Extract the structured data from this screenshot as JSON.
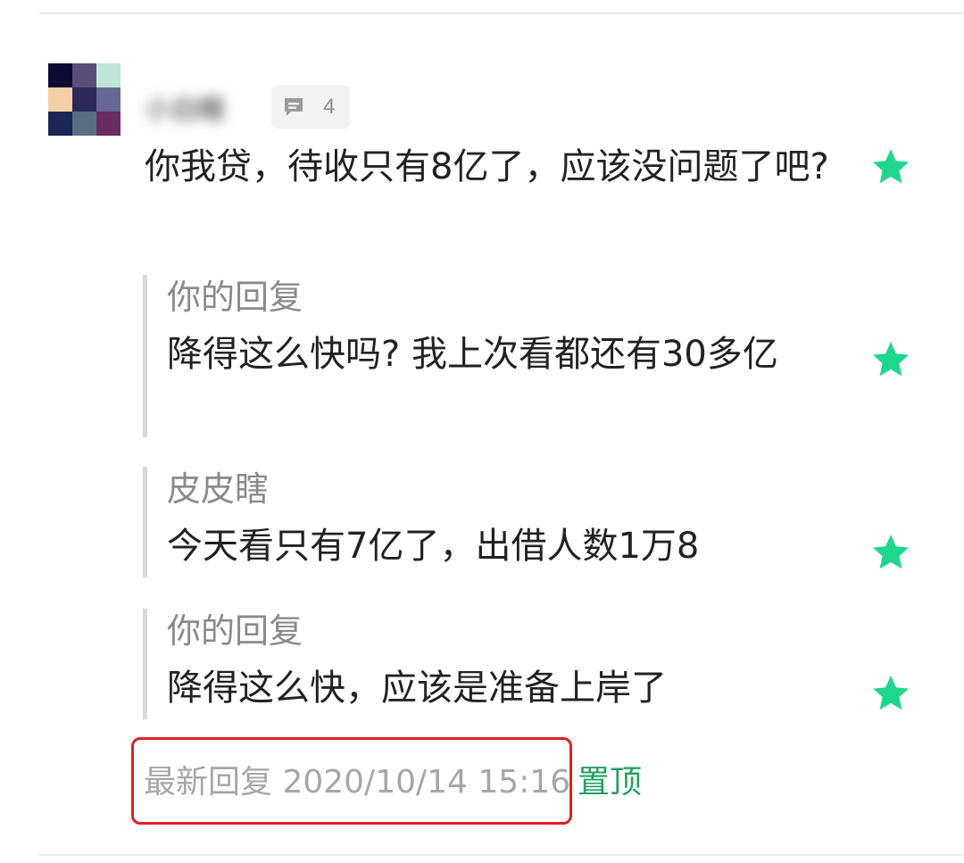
{
  "comment": {
    "username": "小白瞎",
    "reply_count": "4",
    "text": "你我贷，待收只有8亿了，应该没问题了吧?",
    "avatar_colors": [
      "#0d0b36",
      "#5a4f7c",
      "#bde6d6",
      "#f4cfa3",
      "#2d2a5a",
      "#676894",
      "#1d2656",
      "#5b6f80",
      "#6b2c63"
    ]
  },
  "replies": [
    {
      "author": "你的回复",
      "text": "降得这么快吗? 我上次看都还有30多亿"
    },
    {
      "author": "皮皮瞎",
      "text": "今天看只有7亿了，出借人数1万8"
    },
    {
      "author": "你的回复",
      "text": "降得这么快，应该是准备上岸了"
    }
  ],
  "footer": {
    "latest_reply": "最新回复 2020/10/14 15:16",
    "pin_label": "置顶"
  },
  "colors": {
    "star": "#1ed78a",
    "pin": "#22a060",
    "highlight": "#e02020"
  },
  "icons": {
    "reply": "comment-bubble-icon",
    "star": "star-icon"
  }
}
